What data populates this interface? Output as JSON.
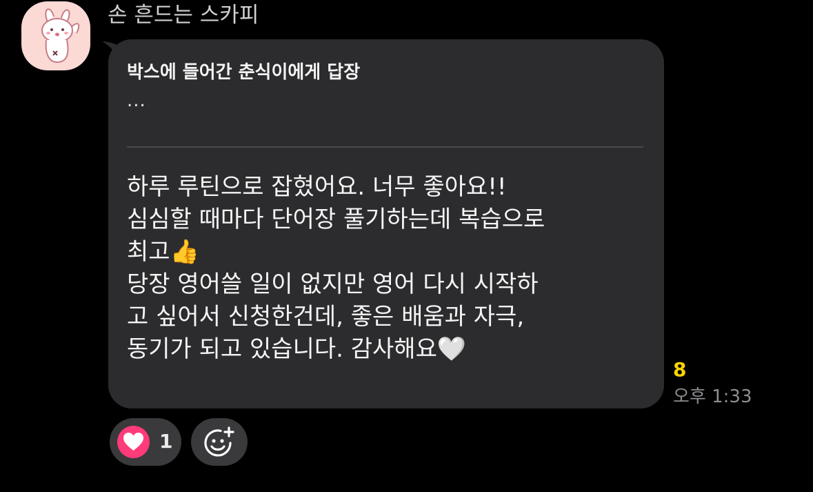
{
  "sender": {
    "name": "손 흔드는 스카피",
    "avatar_icon": "bunny-avatar-icon"
  },
  "message": {
    "reply": {
      "title": "박스에 들어간 춘식이에게 답장",
      "preview": "..."
    },
    "lines": [
      "하루 루틴으로 잡혔어요. 너무 좋아요!!",
      "심심할 때마다 단어장 풀기하는데 복습으로",
      "최고👍",
      "당장 영어쓸 일이 없지만 영어 다시 시작하",
      "고 싶어서 신청한건데, 좋은 배움과 자극,",
      "동기가 되고 있습니다. 감사해요🤍"
    ],
    "unread_count": "8",
    "time": "오후 1:33"
  },
  "reactions": {
    "heart": {
      "icon": "heart-icon",
      "count": "1",
      "color": "#ff3b7a"
    },
    "add_icon": "add-emoji-icon"
  },
  "colors": {
    "background": "#000000",
    "bubble": "#2c2c2e",
    "unread": "#ffd400",
    "chip": "#3a3a3c"
  }
}
